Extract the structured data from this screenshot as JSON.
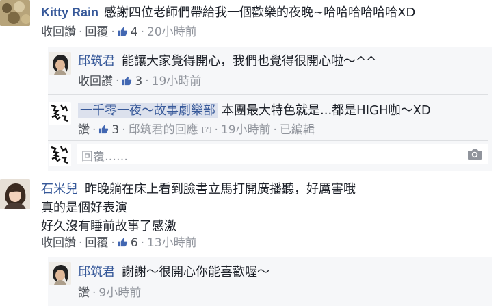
{
  "comments": [
    {
      "author": "Kitty Rain",
      "text": "感謝四位老師們帶給我一個歡樂的夜晚~哈哈哈哈哈哈XD",
      "unlike": "收回讚",
      "reply": "回覆",
      "likes": "4",
      "time": "20小時前"
    },
    {
      "author": "石米兒",
      "text_lines": [
        "昨晚躺在床上看到臉書立馬打開廣播聽，好厲害哦",
        "真的是個好表演",
        "好久沒有睡前故事了感激"
      ],
      "unlike": "收回讚",
      "reply": "回覆",
      "likes": "6",
      "time": "13小時前"
    }
  ],
  "replies": [
    {
      "author": "邱筑君",
      "text": "能讓大家覺得開心，我們也覺得很開心啦～^^",
      "unlike": "收回讚",
      "likes": "3",
      "time": "19小時前"
    },
    {
      "author": "一千零一夜～故事劇樂部",
      "text": "本團最大特色就是...都是HIGH咖～XD",
      "like": "讚",
      "likes": "3",
      "responded_by": "邱筑君的回應",
      "help": "[?]",
      "time": "19小時前",
      "edited": "已編輯"
    },
    {
      "author": "邱筑君",
      "text": "謝謝～很開心你能喜歡喔～",
      "like": "讚",
      "time": "9小時前"
    }
  ],
  "reply_input": {
    "placeholder": "回覆……"
  },
  "page_avatar_text": "故事\n劇樂部"
}
